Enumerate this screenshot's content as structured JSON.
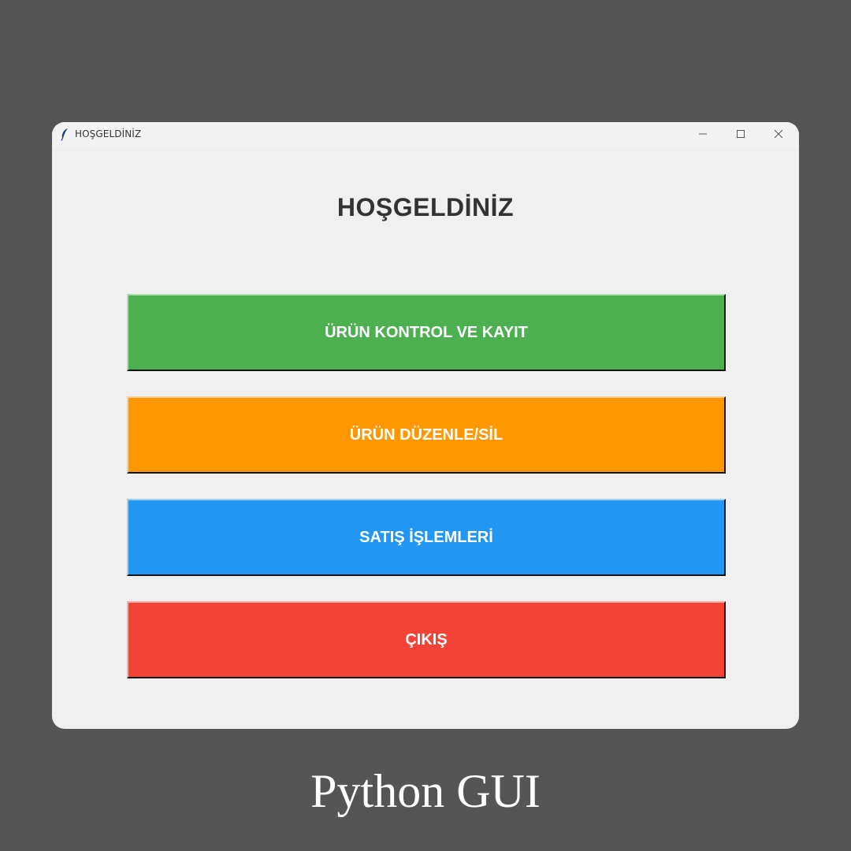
{
  "window": {
    "title": "HOŞGELDİNİZ",
    "app_icon": "feather-icon",
    "controls": [
      "minimize-icon",
      "maximize-icon",
      "close-icon"
    ]
  },
  "main": {
    "heading": "HOŞGELDİNİZ",
    "buttons": [
      {
        "label": "ÜRÜN KONTROL VE KAYIT",
        "color": "#4caf50"
      },
      {
        "label": "ÜRÜN DÜZENLE/SİL",
        "color": "#ff9800"
      },
      {
        "label": "SATIŞ İŞLEMLERİ",
        "color": "#2196f3"
      },
      {
        "label": "ÇIKIŞ",
        "color": "#f44336"
      }
    ]
  },
  "caption": "Python GUI",
  "colors": {
    "background": "#555555",
    "window": "#f0f0f0",
    "heading_text": "#333333",
    "button_text": "#ffffff"
  }
}
